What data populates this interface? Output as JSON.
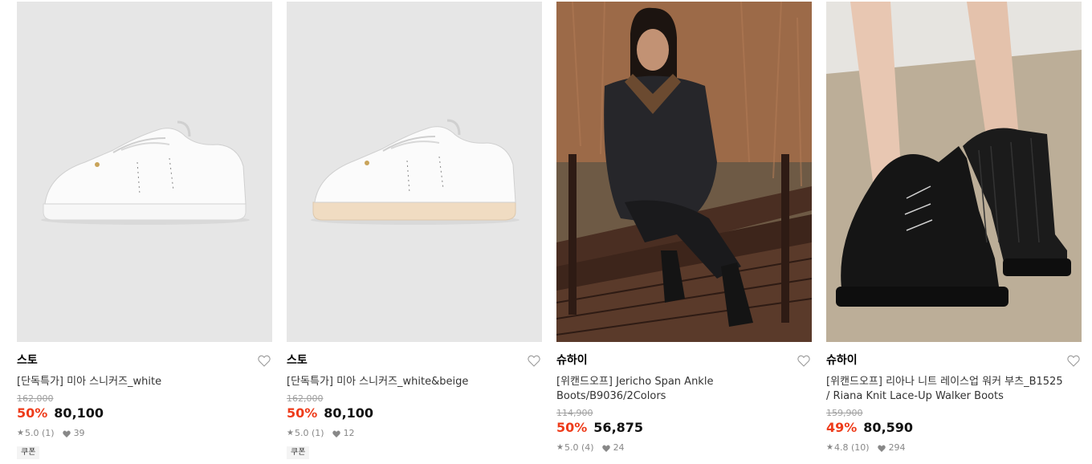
{
  "products": [
    {
      "brand": "스토",
      "name": "[단독특가] 미아 스니커즈_white",
      "original_price": "162,000",
      "discount_rate": "50%",
      "price": "80,100",
      "rating": "5.0",
      "review_count": "(1)",
      "likes": "39",
      "coupon": "쿠폰",
      "image": "white-sneaker-photo"
    },
    {
      "brand": "스토",
      "name": "[단독특가] 미아 스니커즈_white&beige",
      "original_price": "162,000",
      "discount_rate": "50%",
      "price": "80,100",
      "rating": "5.0",
      "review_count": "(1)",
      "likes": "12",
      "coupon": "쿠폰",
      "image": "beige-sole-sneaker-photo"
    },
    {
      "brand": "슈하이",
      "name": "[위캔드오프] Jericho Span Ankle Boots/B9036/2Colors",
      "original_price": "114,900",
      "discount_rate": "50%",
      "price": "56,875",
      "rating": "5.0",
      "review_count": "(4)",
      "likes": "24",
      "image": "model-on-bench-ankle-boots-photo"
    },
    {
      "brand": "슈하이",
      "name": "[위캔드오프] 리아나 니트 레이스업 워커 부츠_B1525 / Riana Knit Lace-Up Walker Boots",
      "original_price": "159,900",
      "discount_rate": "49%",
      "price": "80,590",
      "rating": "4.8",
      "review_count": "(10)",
      "likes": "294",
      "image": "knit-walker-boots-photo"
    }
  ],
  "colors": {
    "discount": "#ee3c1b",
    "thumb_bg": "#e6e6e6",
    "meta_text": "#888888"
  }
}
